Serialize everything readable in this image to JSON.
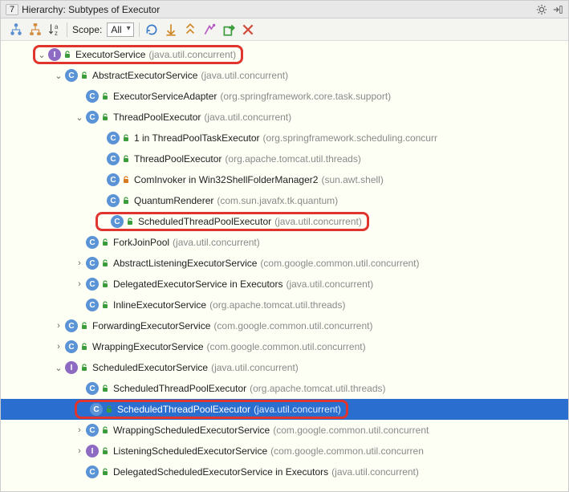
{
  "header": {
    "tab_marker": "7",
    "title": "Hierarchy: Subtypes of Executor"
  },
  "toolbar": {
    "scope_label": "Scope:",
    "scope_value": "All"
  },
  "tree": [
    {
      "id": "executorService",
      "depth": 0,
      "twisty": "open",
      "kind": "I",
      "vis": "green",
      "name": "ExecutorService",
      "pkg": "(java.util.concurrent)",
      "hl": true
    },
    {
      "id": "abstractExecSvc",
      "depth": 1,
      "twisty": "open",
      "kind": "C",
      "vis": "green",
      "name": "AbstractExecutorService",
      "pkg": "(java.util.concurrent)"
    },
    {
      "id": "execSvcAdapter",
      "depth": 2,
      "twisty": "none",
      "kind": "C",
      "vis": "green",
      "name": "ExecutorServiceAdapter",
      "pkg": "(org.springframework.core.task.support)"
    },
    {
      "id": "threadPoolExec",
      "depth": 2,
      "twisty": "open",
      "kind": "C",
      "vis": "green",
      "name": "ThreadPoolExecutor",
      "pkg": "(java.util.concurrent)"
    },
    {
      "id": "anon1",
      "depth": 3,
      "twisty": "none",
      "kind": "C",
      "vis": "green",
      "name": "1 in ThreadPoolTaskExecutor",
      "pkg": "(org.springframework.scheduling.concurr"
    },
    {
      "id": "tpeTomcat",
      "depth": 3,
      "twisty": "none",
      "kind": "C",
      "vis": "green",
      "name": "ThreadPoolExecutor",
      "pkg": "(org.apache.tomcat.util.threads)"
    },
    {
      "id": "comInvoker",
      "depth": 3,
      "twisty": "none",
      "kind": "C",
      "vis": "orange",
      "name": "ComInvoker in Win32ShellFolderManager2",
      "pkg": "(sun.awt.shell)"
    },
    {
      "id": "quantumRenderer",
      "depth": 3,
      "twisty": "none",
      "kind": "C",
      "vis": "green",
      "name": "QuantumRenderer",
      "pkg": "(com.sun.javafx.tk.quantum)"
    },
    {
      "id": "stpe1",
      "depth": 3,
      "twisty": "none",
      "kind": "C",
      "vis": "green",
      "name": "ScheduledThreadPoolExecutor",
      "pkg": "(java.util.concurrent)",
      "hl": true
    },
    {
      "id": "forkJoinPool",
      "depth": 2,
      "twisty": "none",
      "kind": "C",
      "vis": "green",
      "name": "ForkJoinPool",
      "pkg": "(java.util.concurrent)"
    },
    {
      "id": "abstractListening",
      "depth": 2,
      "twisty": "closed",
      "kind": "C",
      "vis": "green",
      "name": "AbstractListeningExecutorService",
      "pkg": "(com.google.common.util.concurrent)"
    },
    {
      "id": "delegatedExec1",
      "depth": 2,
      "twisty": "closed",
      "kind": "C",
      "vis": "green",
      "name": "DelegatedExecutorService in Executors",
      "pkg": "(java.util.concurrent)"
    },
    {
      "id": "inlineExec",
      "depth": 2,
      "twisty": "none",
      "kind": "C",
      "vis": "green",
      "name": "InlineExecutorService",
      "pkg": "(org.apache.tomcat.util.threads)"
    },
    {
      "id": "forwardingExec",
      "depth": 1,
      "twisty": "closed",
      "kind": "C",
      "vis": "green",
      "name": "ForwardingExecutorService",
      "pkg": "(com.google.common.util.concurrent)"
    },
    {
      "id": "wrappingExec",
      "depth": 1,
      "twisty": "closed",
      "kind": "C",
      "vis": "green",
      "name": "WrappingExecutorService",
      "pkg": "(com.google.common.util.concurrent)"
    },
    {
      "id": "schedExecSvc",
      "depth": 1,
      "twisty": "open",
      "kind": "I",
      "vis": "green",
      "name": "ScheduledExecutorService",
      "pkg": "(java.util.concurrent)"
    },
    {
      "id": "stpeTomcat",
      "depth": 2,
      "twisty": "none",
      "kind": "C",
      "vis": "green",
      "name": "ScheduledThreadPoolExecutor",
      "pkg": "(org.apache.tomcat.util.threads)"
    },
    {
      "id": "stpe2",
      "depth": 2,
      "twisty": "none",
      "kind": "C",
      "vis": "green",
      "name": "ScheduledThreadPoolExecutor",
      "pkg": "(java.util.concurrent)",
      "hl": true,
      "selected": true
    },
    {
      "id": "wrappingSched",
      "depth": 2,
      "twisty": "closed",
      "kind": "C",
      "vis": "green",
      "name": "WrappingScheduledExecutorService",
      "pkg": "(com.google.common.util.concurrent"
    },
    {
      "id": "listeningSched",
      "depth": 2,
      "twisty": "closed",
      "kind": "I",
      "vis": "green",
      "name": "ListeningScheduledExecutorService",
      "pkg": "(com.google.common.util.concurren"
    },
    {
      "id": "delegatedSched",
      "depth": 2,
      "twisty": "none",
      "kind": "C",
      "vis": "green",
      "name": "DelegatedScheduledExecutorService in Executors",
      "pkg": "(java.util.concurrent)"
    }
  ]
}
